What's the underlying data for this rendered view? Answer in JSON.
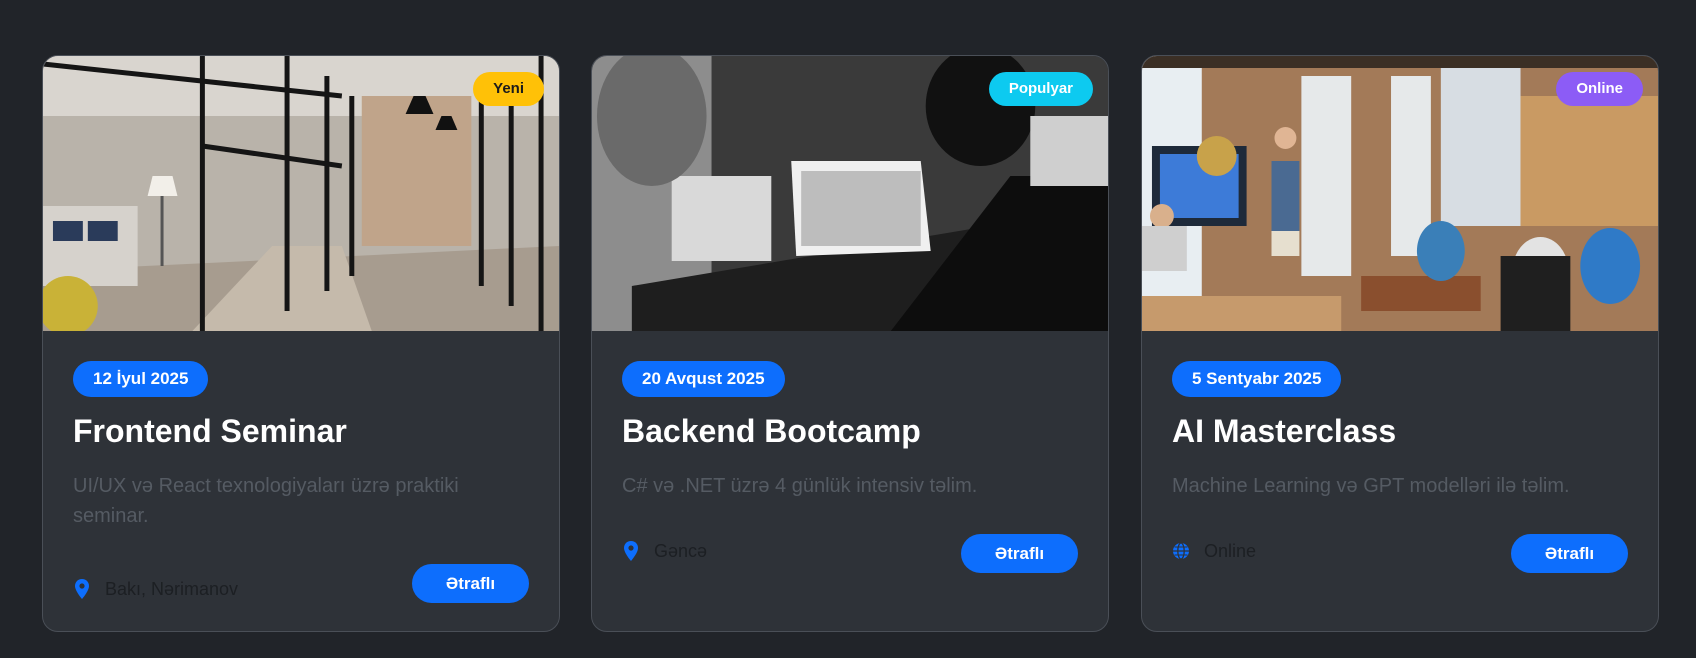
{
  "colors": {
    "background": "#212429",
    "card": "#2e3238",
    "accent": "#0d6efd",
    "tag_yellow": "#ffc107",
    "tag_cyan": "#0dcaf0",
    "tag_purple": "#8c5cf6"
  },
  "cards": [
    {
      "image": "office-hallway-photo",
      "tag": "Yeni",
      "date": "12 İyul 2025",
      "title": "Frontend Seminar",
      "description": "UI/UX və React texnologiyaları üzrə praktiki seminar.",
      "location_icon": "map-pin-icon",
      "location": "Bakı, Nərimanov",
      "button": "Ətraflı"
    },
    {
      "image": "laptops-meeting-photo",
      "tag": "Populyar",
      "date": "20 Avqust 2025",
      "title": "Backend Bootcamp",
      "description": "C# və .NET üzrə 4 günlük intensiv təlim.",
      "location_icon": "map-pin-icon",
      "location": "Gəncə",
      "button": "Ətraflı"
    },
    {
      "image": "presentation-room-photo",
      "tag": "Online",
      "date": "5 Sentyabr 2025",
      "title": "AI Masterclass",
      "description": "Machine Learning və GPT modelləri ilə təlim.",
      "location_icon": "globe-icon",
      "location": "Online",
      "button": "Ətraflı"
    }
  ]
}
